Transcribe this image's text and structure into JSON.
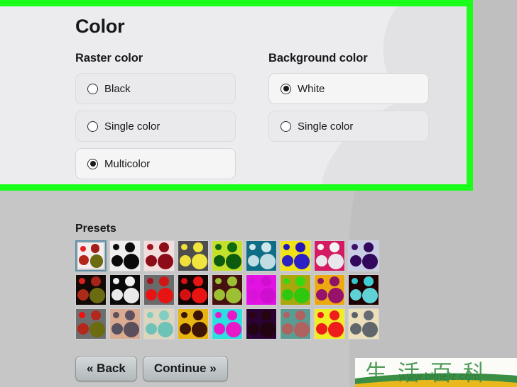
{
  "page": {
    "title": "Color",
    "background_color": "#c6c6c6",
    "panel_color": "#ececee",
    "highlight_frame_color": "#1aff1a"
  },
  "raster_color": {
    "group_title": "Raster color",
    "options": [
      {
        "label": "Black",
        "selected": false
      },
      {
        "label": "Single color",
        "selected": false
      },
      {
        "label": "Multicolor",
        "selected": true
      }
    ]
  },
  "background_color": {
    "group_title": "Background color",
    "options": [
      {
        "label": "White",
        "selected": true
      },
      {
        "label": "Single color",
        "selected": false
      }
    ]
  },
  "presets": {
    "title": "Presets",
    "selected_index": 0,
    "rows": [
      [
        {
          "bg": "#f6eeee",
          "dots": [
            "#e81f1f",
            "#a32018",
            "#b3251b",
            "#6b6b12"
          ],
          "selected": true
        },
        {
          "bg": "#eeeeee",
          "dots": [
            "#0a0a0a",
            "#0a0a0a",
            "#0a0a0a",
            "#0a0a0a"
          ],
          "selected": false
        },
        {
          "bg": "#f3dede",
          "dots": [
            "#a01220",
            "#8c0d18",
            "#8c0d18",
            "#8c0d18"
          ],
          "selected": false
        },
        {
          "bg": "#4d4d4d",
          "dots": [
            "#efe03a",
            "#efe53e",
            "#efe03a",
            "#efe53e"
          ],
          "selected": false
        },
        {
          "bg": "#c3e02a",
          "dots": [
            "#116611",
            "#0f6b12",
            "#0d5c10",
            "#0d5c10"
          ],
          "selected": false
        },
        {
          "bg": "#0d6e85",
          "dots": [
            "#cfe6ea",
            "#cfe6ea",
            "#bfdde3",
            "#bfdde3"
          ],
          "selected": false
        },
        {
          "bg": "#f2e317",
          "dots": [
            "#2416b8",
            "#2416b8",
            "#2d21c4",
            "#2d21c4"
          ],
          "selected": false
        },
        {
          "bg": "#d41a63",
          "dots": [
            "#f4f4f4",
            "#f4f4f4",
            "#e8e8ec",
            "#e8e8ec"
          ],
          "selected": false
        },
        {
          "bg": "#c8cce4",
          "dots": [
            "#3d0f63",
            "#33085c",
            "#33085c",
            "#33085c"
          ],
          "selected": false
        }
      ],
      [
        {
          "bg": "#120a06",
          "dots": [
            "#e02020",
            "#a4241a",
            "#ab2a18",
            "#6b6b12"
          ],
          "selected": false
        },
        {
          "bg": "#0a0a0a",
          "dots": [
            "#f0f0f0",
            "#f0f0f0",
            "#eaeaea",
            "#eaeaea"
          ],
          "selected": false
        },
        {
          "bg": "#6a6a6a",
          "dots": [
            "#a8101a",
            "#cf1515",
            "#e81414",
            "#e81414"
          ],
          "selected": false
        },
        {
          "bg": "#140505",
          "dots": [
            "#d41010",
            "#e81414",
            "#d51010",
            "#e81414"
          ],
          "selected": false
        },
        {
          "bg": "#461211",
          "dots": [
            "#9cbf33",
            "#9cbf33",
            "#9cbf33",
            "#9cbf33"
          ],
          "selected": false
        },
        {
          "bg": "#e212e2",
          "dots": [
            "#d812d8",
            "#cf0fcf",
            "#d812d8",
            "#cf0fcf"
          ],
          "selected": false
        },
        {
          "bg": "#a8a80e",
          "dots": [
            "#39d612",
            "#39d612",
            "#2fc80e",
            "#2fc80e"
          ],
          "selected": false
        },
        {
          "bg": "#edaa10",
          "dots": [
            "#8c1463",
            "#8c1463",
            "#96126b",
            "#96126b"
          ],
          "selected": false
        },
        {
          "bg": "#200000",
          "dots": [
            "#35c5cd",
            "#3ecfd6",
            "#5ed2d6",
            "#5ed2d6"
          ],
          "selected": false
        }
      ],
      [
        {
          "bg": "#6e6e6e",
          "dots": [
            "#f01010",
            "#b3281a",
            "#b3281a",
            "#6b6b12"
          ],
          "selected": false
        },
        {
          "bg": "#dbab91",
          "dots": [
            "#5d4f5c",
            "#5d5060",
            "#555062",
            "#5a4f5d"
          ],
          "selected": false
        },
        {
          "bg": "#dcd6bf",
          "dots": [
            "#83ccc2",
            "#83ccc2",
            "#6fc2b8",
            "#6fc2b8"
          ],
          "selected": false
        },
        {
          "bg": "#e8b510",
          "dots": [
            "#3d1406",
            "#3d1406",
            "#3d1406",
            "#3d1406"
          ],
          "selected": false
        },
        {
          "bg": "#2ae0e0",
          "dots": [
            "#e818c8",
            "#e818c8",
            "#e818c8",
            "#e818c8"
          ],
          "selected": false
        },
        {
          "bg": "#2a0333",
          "dots": [
            "#2a0410",
            "#240410",
            "#220310",
            "#220310"
          ],
          "selected": false
        },
        {
          "bg": "#5a9b94",
          "dots": [
            "#b0625f",
            "#b0625f",
            "#b0625f",
            "#b0625f"
          ],
          "selected": false
        },
        {
          "bg": "#f0ec25",
          "dots": [
            "#ef1c1c",
            "#ef1c1c",
            "#ef1c1c",
            "#ef1c1c"
          ],
          "selected": false
        },
        {
          "bg": "#ece0ba",
          "dots": [
            "#5b6068",
            "#666c72",
            "#60666c",
            "#60666c"
          ],
          "selected": false
        }
      ]
    ]
  },
  "footer": {
    "back_label": "« Back",
    "continue_label": "Continue »"
  },
  "watermark": {
    "characters": "生活百科",
    "url": "www.bimeiz.com"
  }
}
